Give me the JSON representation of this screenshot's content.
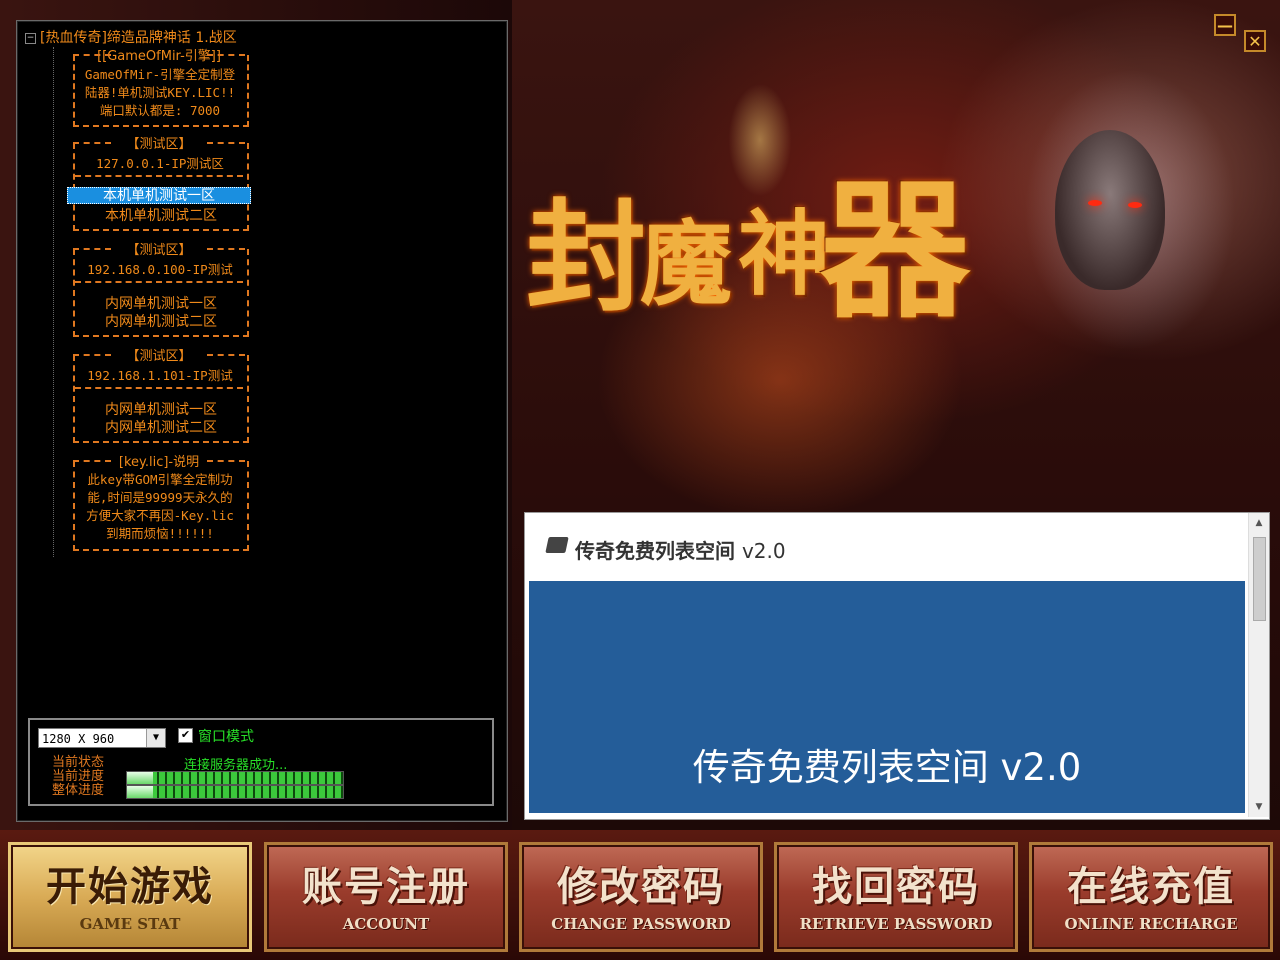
{
  "app": {
    "window_title": "[热血传奇]缔造品牌神话 1.战区"
  },
  "window_controls": {
    "minimize": "—",
    "close": "✕"
  },
  "logo": {
    "text": [
      "封",
      "魔",
      "神",
      "器"
    ]
  },
  "tree": {
    "root": "[热血传奇]缔造品牌神话 1.战区",
    "info": {
      "title": "[[GameOfMir-引擎]]",
      "lines": [
        "GameOfMir-引擎全定制登",
        "陆器!单机测试KEY.LIC!!",
        "端口默认都是: 7000"
      ]
    },
    "groups": [
      {
        "title": "【测试区】",
        "header": "127.0.0.1-IP测试区",
        "items": [
          "本机单机测试一区",
          "本机单机测试二区"
        ]
      },
      {
        "title": "【测试区】",
        "header": "192.168.0.100-IP测试",
        "items": [
          "内网单机测试一区",
          "内网单机测试二区"
        ]
      },
      {
        "title": "【测试区】",
        "header": "192.168.1.101-IP测试",
        "items": [
          "内网单机测试一区",
          "内网单机测试二区"
        ]
      }
    ],
    "keyinfo": {
      "title": "[key.lic]-说明",
      "lines": [
        "此key带GOM引擎全定制功",
        "能,时间是99999天永久的",
        "方便大家不再因-Key.lic",
        "到期而烦恼!!!!!!"
      ]
    },
    "selected": "本机单机测试一区"
  },
  "status": {
    "resolution": "1280 X 960",
    "window_mode_label": "窗口模式",
    "window_mode_checked": true,
    "labels": [
      "当前状态",
      "当前进度",
      "整体进度"
    ],
    "status_text": "连接服务器成功...",
    "current_progress": 100,
    "overall_progress": 100
  },
  "web": {
    "title": "传奇免费列表空间",
    "version": "v2.0",
    "banner": "传奇免费列表空间 v2.0"
  },
  "buttons": [
    {
      "zh": "开始游戏",
      "en": "GAME STAT",
      "style": "gold"
    },
    {
      "zh": "账号注册",
      "en": "ACCOUNT",
      "style": "red"
    },
    {
      "zh": "修改密码",
      "en": "CHANGE PASSWORD",
      "style": "red"
    },
    {
      "zh": "找回密码",
      "en": "RETRIEVE PASSWORD",
      "style": "red"
    },
    {
      "zh": "在线充值",
      "en": "ONLINE RECHARGE",
      "style": "red"
    }
  ],
  "colors": {
    "accent_orange": "#f08a1a",
    "status_green": "#28e028",
    "web_banner": "#245d99",
    "selection": "#1a8fe0"
  }
}
